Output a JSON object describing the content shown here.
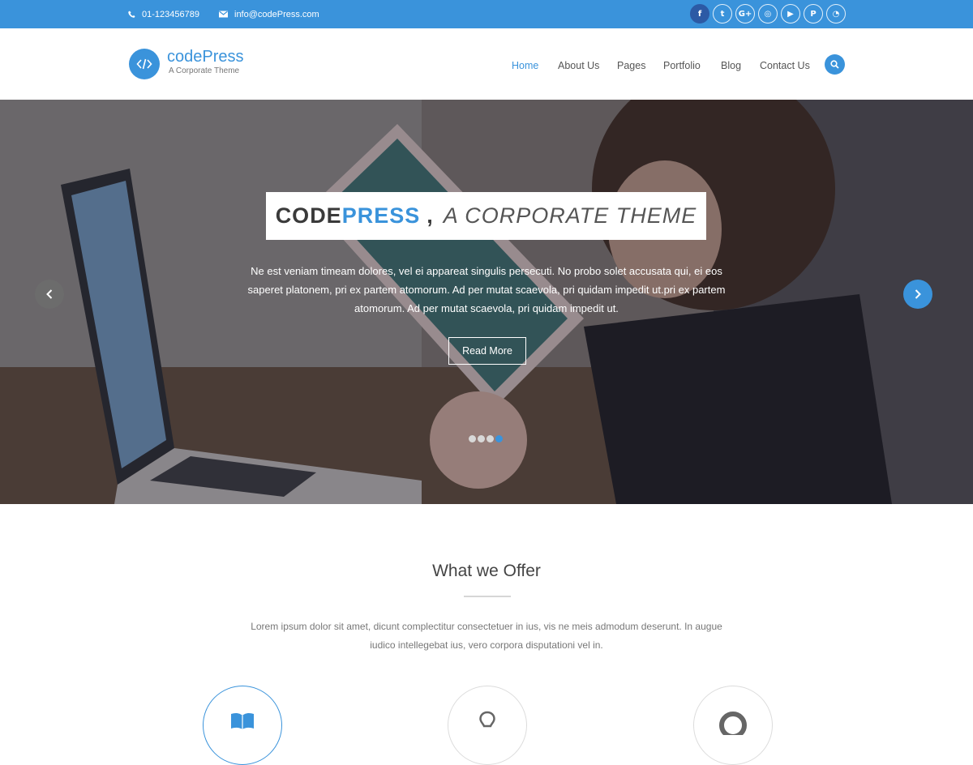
{
  "topbar": {
    "phone": "01-123456789",
    "email": "info@codePress.com",
    "socials": [
      {
        "icon": "facebook-icon",
        "glyph": "f"
      },
      {
        "icon": "twitter-icon",
        "glyph": "t"
      },
      {
        "icon": "google-plus-icon",
        "glyph": "G+"
      },
      {
        "icon": "instagram-icon",
        "glyph": "◎"
      },
      {
        "icon": "youtube-icon",
        "glyph": "▶"
      },
      {
        "icon": "pinterest-icon",
        "glyph": "P"
      },
      {
        "icon": "rss-icon",
        "glyph": "◔"
      }
    ]
  },
  "header": {
    "logo_title": "codePress",
    "logo_tagline": "A Corporate Theme",
    "nav": [
      "Home",
      "About Us",
      "Pages",
      "Portfolio",
      "Blog",
      "Contact Us"
    ],
    "active_nav": "Home"
  },
  "hero": {
    "title_part1": "CODE",
    "title_part2": "PRESS",
    "title_part3": ",",
    "title_part4": "A CORPORATE THEME",
    "text": "Ne est veniam timeam dolores, vel ei appareat singulis persecuti. No probo solet accusata qui, ei eos saperet platonem, pri ex partem atomorum. Ad per mutat scaevola, pri quidam impedit ut.pri ex partem atomorum. Ad per mutat scaevola, pri quidam impedit ut.",
    "button": "Read More",
    "slides_total": 4,
    "active_slide": 4
  },
  "offer": {
    "title": "What we Offer",
    "text": "Lorem ipsum dolor sit amet, dicunt complectitur consectetuer in ius, vis ne meis admodum deserunt. In augue iudico intellegebat ius, vero corpora disputationi vel in."
  },
  "colors": {
    "accent": "#3a93db",
    "topbar": "#3a93db",
    "active_social": "#2c5aa5",
    "text": "#555555"
  }
}
